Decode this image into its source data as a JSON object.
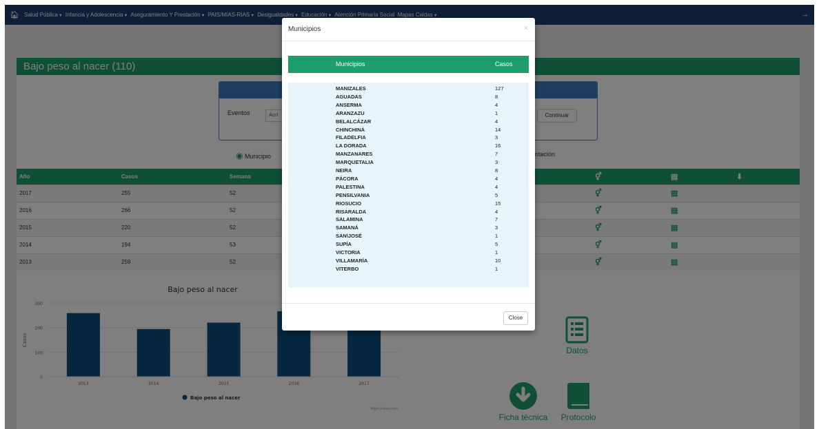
{
  "nav": {
    "items": [
      "Salud Pública",
      "Infancia y Adolescencia",
      "Aseguramiento Y Prestación",
      "PAIS/MIAS-RIAS",
      "Desigualdades",
      "Educación",
      "Atención Primaria Social",
      "Mapas Caldas"
    ]
  },
  "panel": {
    "title": "Bajo peso al nacer (110)",
    "filter_label": "Eventos",
    "filter_value": "Acci",
    "continue_label": "Continuar",
    "municipios_label": "Municipio",
    "orientacion_label": "ntación"
  },
  "table": {
    "headers": [
      "Año",
      "Casos",
      "Semana"
    ],
    "rows": [
      {
        "year": "2017",
        "cases": "255",
        "week": "52"
      },
      {
        "year": "2016",
        "cases": "266",
        "week": "52"
      },
      {
        "year": "2015",
        "cases": "220",
        "week": "52"
      },
      {
        "year": "2014",
        "cases": "194",
        "week": "53"
      },
      {
        "year": "2013",
        "cases": "259",
        "week": "52"
      }
    ]
  },
  "chart_data": {
    "type": "bar",
    "title": "Bajo peso al nacer",
    "ylabel": "Casos",
    "xlabel": "",
    "categories": [
      "2013",
      "2014",
      "2015",
      "2016",
      "2017"
    ],
    "series": [
      {
        "name": "Bajo peso al nacer",
        "values": [
          259,
          194,
          220,
          266,
          255
        ]
      }
    ],
    "ylim": [
      0,
      300
    ],
    "yticks": [
      "0",
      "100",
      "200",
      "300"
    ],
    "credits": "Highcharts.com",
    "color": "#0d4f7c"
  },
  "links": {
    "datos": "Datos",
    "ficha": "Ficha técnica",
    "protocolo": "Protocolo"
  },
  "modal": {
    "title": "Municipios",
    "col_municipio": "Municipios",
    "col_casos": "Casos",
    "close_label": "Close",
    "rows": [
      {
        "name": "MANIZALES",
        "casos": "127"
      },
      {
        "name": "AGUADAS",
        "casos": "8"
      },
      {
        "name": "ANSERMA",
        "casos": "4"
      },
      {
        "name": "ARANZAZU",
        "casos": "1"
      },
      {
        "name": "BELALCÁZAR",
        "casos": "4"
      },
      {
        "name": "CHINCHINÁ",
        "casos": "14"
      },
      {
        "name": "FILADELFIA",
        "casos": "3"
      },
      {
        "name": "LA DORADA",
        "casos": "16"
      },
      {
        "name": "MANZANARES",
        "casos": "7"
      },
      {
        "name": "MARQUETALIA",
        "casos": "3"
      },
      {
        "name": "NEIRA",
        "casos": "8"
      },
      {
        "name": "PÁCORA",
        "casos": "4"
      },
      {
        "name": "PALESTINA",
        "casos": "4"
      },
      {
        "name": "PENSILVANIA",
        "casos": "5"
      },
      {
        "name": "RIOSUCIO",
        "casos": "15"
      },
      {
        "name": "RISARALDA",
        "casos": "4"
      },
      {
        "name": "SALAMINA",
        "casos": "7"
      },
      {
        "name": "SAMANÁ",
        "casos": "3"
      },
      {
        "name": "SAN\\JOSÉ",
        "casos": "1"
      },
      {
        "name": "SUPÍA",
        "casos": "5"
      },
      {
        "name": "VICTORIA",
        "casos": "1"
      },
      {
        "name": "VILLAMARÍA",
        "casos": "10"
      },
      {
        "name": "VITERBO",
        "casos": "1"
      }
    ]
  }
}
